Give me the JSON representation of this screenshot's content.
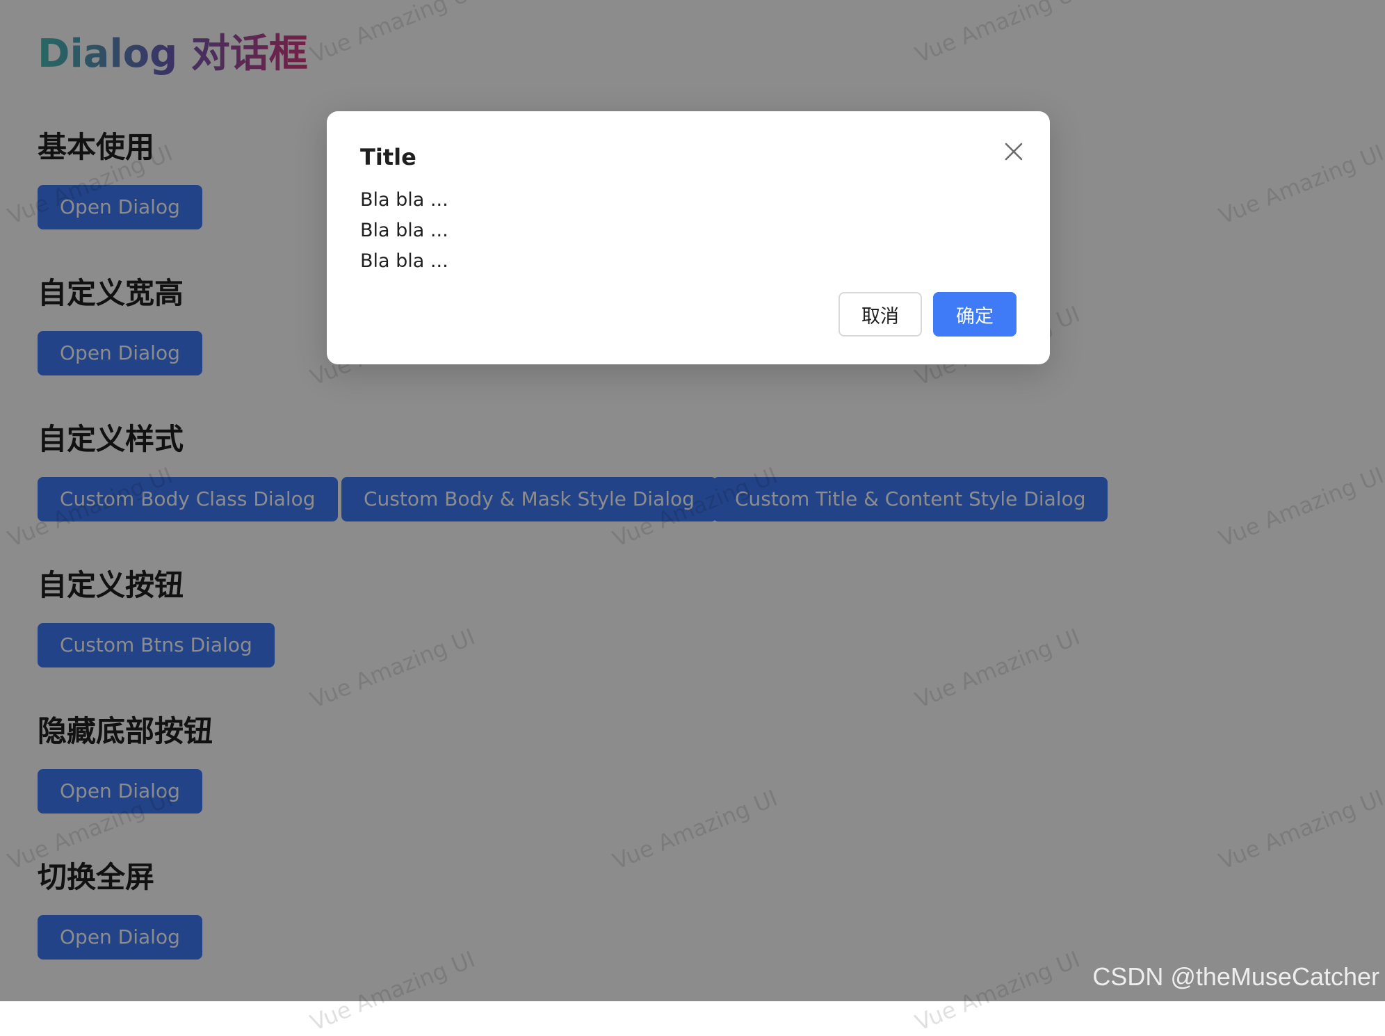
{
  "page": {
    "title": "Dialog 对话框"
  },
  "sections": [
    {
      "title": "基本使用",
      "buttons": [
        "Open Dialog"
      ]
    },
    {
      "title": "自定义宽高",
      "buttons": [
        "Open Dialog"
      ]
    },
    {
      "title": "自定义样式",
      "buttons": [
        "Custom Body Class Dialog",
        "Custom Body & Mask Style Dialog",
        "Custom Title & Content Style Dialog"
      ]
    },
    {
      "title": "自定义按钮",
      "buttons": [
        "Custom Btns Dialog"
      ]
    },
    {
      "title": "隐藏底部按钮",
      "buttons": [
        "Open Dialog"
      ]
    },
    {
      "title": "切换全屏",
      "buttons": [
        "Open Dialog"
      ]
    }
  ],
  "watermark_text": "Vue Amazing UI",
  "dialog": {
    "title": "Title",
    "content_lines": [
      "Bla bla ...",
      "Bla bla ...",
      "Bla bla ..."
    ],
    "cancel_label": "取消",
    "ok_label": "确定",
    "close_icon": "close-icon"
  },
  "colors": {
    "primary": "#3f7bf7",
    "mask": "rgba(0,0,0,0.45)"
  },
  "footer_watermark": "CSDN @theMuseCatcher"
}
